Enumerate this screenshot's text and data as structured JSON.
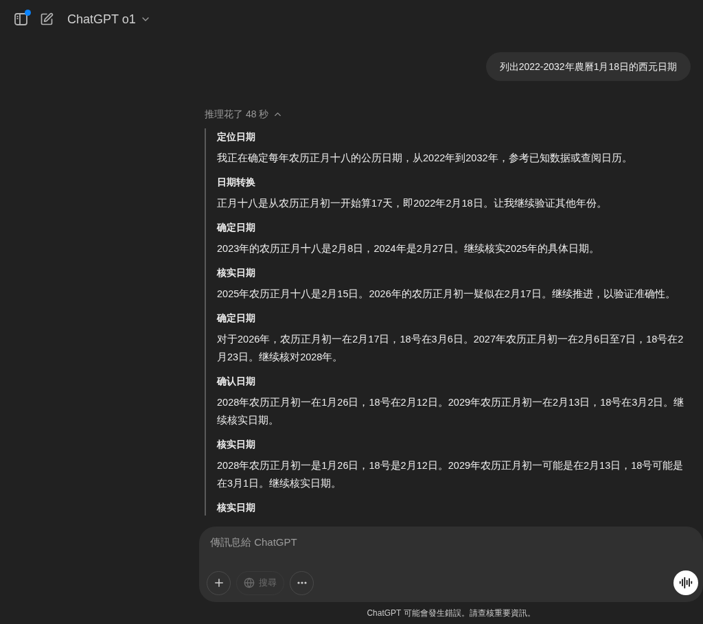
{
  "header": {
    "model": "ChatGPT o1",
    "notification": true
  },
  "user_message": "列出2022-2032年農曆1月18日的西元日期",
  "reasoning": {
    "summary": "推理花了 48 秒",
    "expanded": true,
    "steps": [
      {
        "title": "定位日期",
        "text": "我正在确定每年农历正月十八的公历日期，从2022年到2032年，参考已知数据或查阅日历。"
      },
      {
        "title": "日期转换",
        "text": "正月十八是从农历正月初一开始算17天，即2022年2月18日。让我继续验证其他年份。"
      },
      {
        "title": "确定日期",
        "text": "2023年的农历正月十八是2月8日，2024年是2月27日。继续核实2025年的具体日期。"
      },
      {
        "title": "核实日期",
        "text": "2025年农历正月十八是2月15日。2026年的农历正月初一疑似在2月17日。继续推进，以验证准确性。"
      },
      {
        "title": "确定日期",
        "text": "对于2026年，农历正月初一在2月17日，18号在3月6日。2027年农历正月初一在2月6日至7日，18号在2月23日。继续核对2028年。"
      },
      {
        "title": "确认日期",
        "text": "2028年农历正月初一在1月26日，18号在2月12日。2029年农历正月初一在2月13日，18号在3月2日。继续核实日期。"
      },
      {
        "title": "核实日期",
        "text": "2028年农历正月初一是1月26日，18号是2月12日。2029年农历正月初一可能是在2月13日，18号可能是在3月1日。继续核实日期。"
      },
      {
        "title": "核实日期"
      }
    ]
  },
  "composer": {
    "placeholder": "傳訊息給 ChatGPT",
    "search": {
      "label": "搜尋",
      "disabled": true
    }
  },
  "disclaimer": "ChatGPT 可能會發生錯誤。請查核重要資訊。"
}
